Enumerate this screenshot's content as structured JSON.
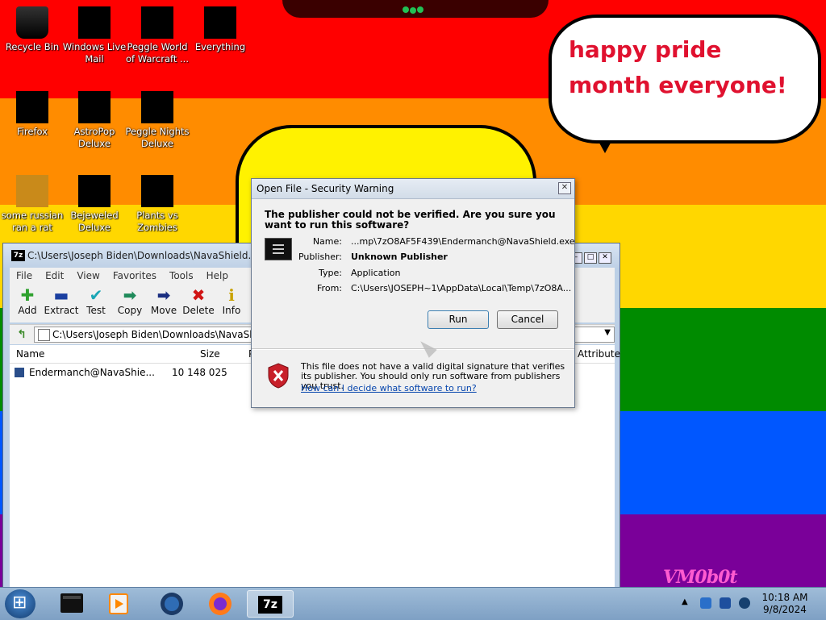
{
  "desktop": {
    "bubble_text": "happy pride month everyone!",
    "watermark": "VM0b0t",
    "icons": [
      {
        "label": "Recycle Bin",
        "icon": "recycle-bin-icon"
      },
      {
        "label": "Windows Live Mail",
        "icon": "mail-icon"
      },
      {
        "label": "Peggle World of Warcraft ...",
        "icon": "game-icon"
      },
      {
        "label": "Everything",
        "icon": "search-icon"
      },
      {
        "label": "Firefox",
        "icon": "firefox-icon"
      },
      {
        "label": "AstroPop Deluxe",
        "icon": "game-icon"
      },
      {
        "label": "Peggle Nights Deluxe",
        "icon": "game-icon"
      },
      {
        "label": "some russian ran a rat",
        "icon": "app-icon"
      },
      {
        "label": "Bejeweled Deluxe",
        "icon": "game-icon"
      },
      {
        "label": "Plants vs Zombies",
        "icon": "game-icon"
      }
    ],
    "colors": {
      "red": "#ff0000",
      "orange": "#ff8c00",
      "yellow": "#ffd700",
      "green": "#008b00",
      "blue": "#0057ff",
      "purple": "#7a0099"
    }
  },
  "zip_window": {
    "title": "C:\\Users\\Joseph Biden\\Downloads\\NavaShield.zip\\",
    "menu": [
      "File",
      "Edit",
      "View",
      "Favorites",
      "Tools",
      "Help"
    ],
    "toolbar": [
      "Add",
      "Extract",
      "Test",
      "Copy",
      "Move",
      "Delete",
      "Info"
    ],
    "address": "C:\\Users\\Joseph Biden\\Downloads\\NavaShield",
    "columns": {
      "name": "Name",
      "size": "Size",
      "attributes": "Attribute"
    },
    "rows": [
      {
        "name": "Endermanch@NavaShie...",
        "size": "10 148 025"
      }
    ]
  },
  "dialog": {
    "title": "Open File - Security Warning",
    "question": "The publisher could not be verified.  Are you sure you want to run this software?",
    "fields": {
      "name_label": "Name:",
      "name_value": "...mp\\7zO8AF5F439\\Endermanch@NavaShield.exe",
      "publisher_label": "Publisher:",
      "publisher_value": "Unknown Publisher",
      "type_label": "Type:",
      "type_value": "Application",
      "from_label": "From:",
      "from_value": "C:\\Users\\JOSEPH~1\\AppData\\Local\\Temp\\7zO8A..."
    },
    "run_label": "Run",
    "cancel_label": "Cancel",
    "warning": "This file does not have a valid digital signature that verifies its publisher.  You should only run software from publishers you trust.",
    "link": "How can I decide what software to run?"
  },
  "taskbar": {
    "time": "10:18 AM",
    "date": "9/8/2024",
    "apps": [
      "terminal-icon",
      "media-player-icon",
      "globe-icon",
      "firefox-icon",
      "7zip-icon"
    ],
    "active_app_label": "7z"
  }
}
